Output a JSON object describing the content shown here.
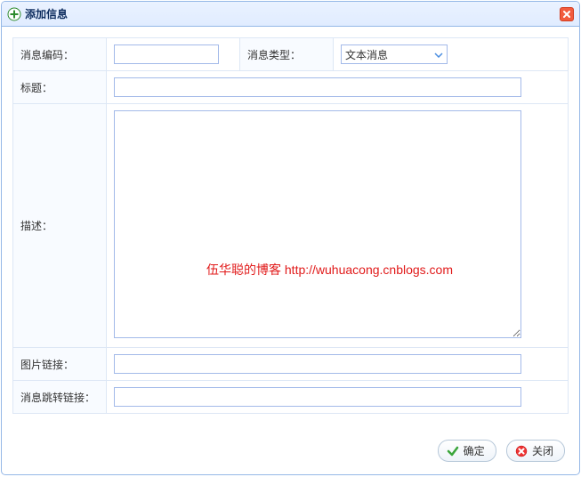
{
  "dialog": {
    "title": "添加信息"
  },
  "form": {
    "code_label": "消息编码：",
    "code_value": "",
    "type_label": "消息类型：",
    "type_value": "文本消息",
    "title_label": "标题：",
    "title_value": "",
    "desc_label": "描述：",
    "desc_value": "",
    "image_label": "图片链接：",
    "image_value": "",
    "jump_label": "消息跳转链接：",
    "jump_value": ""
  },
  "buttons": {
    "ok": "确定",
    "close": "关闭"
  },
  "watermark": "伍华聪的博客 http://wuhuacong.cnblogs.com"
}
